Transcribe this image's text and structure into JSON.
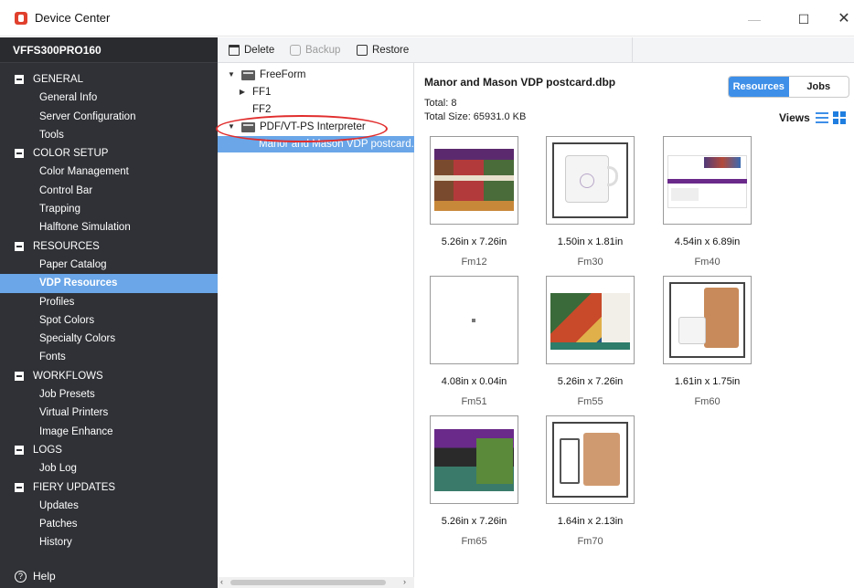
{
  "window": {
    "title": "Device Center"
  },
  "sidebar": {
    "device_name": "VFFS300PRO160",
    "groups": [
      {
        "label": "GENERAL",
        "items": [
          "General Info",
          "Server Configuration",
          "Tools"
        ]
      },
      {
        "label": "COLOR SETUP",
        "items": [
          "Color Management",
          "Control Bar",
          "Trapping",
          "Halftone Simulation"
        ]
      },
      {
        "label": "RESOURCES",
        "items": [
          "Paper Catalog",
          "VDP Resources",
          "Profiles",
          "Spot Colors",
          "Specialty Colors",
          "Fonts"
        ]
      },
      {
        "label": "WORKFLOWS",
        "items": [
          "Job Presets",
          "Virtual Printers",
          "Image Enhance"
        ]
      },
      {
        "label": "LOGS",
        "items": [
          "Job Log"
        ]
      },
      {
        "label": "FIERY UPDATES",
        "items": [
          "Updates",
          "Patches",
          "History"
        ]
      }
    ],
    "selected_item": "VDP Resources",
    "help_label": "Help"
  },
  "toolbar": {
    "delete_label": "Delete",
    "backup_label": "Backup",
    "restore_label": "Restore"
  },
  "tree": {
    "nodes": [
      {
        "label": "FreeForm",
        "expander": "▼"
      },
      {
        "label": "FF1",
        "expander": "▶"
      },
      {
        "label": "FF2",
        "expander": ""
      },
      {
        "label": "PDF/VT-PS Interpreter",
        "expander": "▼"
      },
      {
        "label": "Manor and Mason VDP postcard.d",
        "expander": ""
      }
    ]
  },
  "content": {
    "file_title": "Manor and Mason VDP postcard.dbp",
    "total": "Total: 8",
    "total_size": "Total Size: 65931.0 KB",
    "tabs": [
      "Resources",
      "Jobs"
    ],
    "active_tab": "Resources",
    "views_label": "Views",
    "thumbnails": [
      {
        "dims": "5.26in x 7.26in",
        "name": "Fm12"
      },
      {
        "dims": "1.50in x 1.81in",
        "name": "Fm30"
      },
      {
        "dims": "4.54in x 6.89in",
        "name": "Fm40"
      },
      {
        "dims": "4.08in x 0.04in",
        "name": "Fm51"
      },
      {
        "dims": "5.26in x 7.26in",
        "name": "Fm55"
      },
      {
        "dims": "1.61in x 1.75in",
        "name": "Fm60"
      },
      {
        "dims": "5.26in x 7.26in",
        "name": "Fm65"
      },
      {
        "dims": "1.64in x 2.13in",
        "name": "Fm70"
      }
    ]
  },
  "colors": {
    "sidebar_bg": "#2f3136",
    "selection": "#6aa6e8",
    "accent": "#3e8fe8",
    "annotation": "#e12d2d"
  },
  "icons": [
    "app-icon",
    "trash-icon",
    "backup-icon",
    "restore-icon",
    "list-view-icon",
    "grid-view-icon",
    "help-icon",
    "folder-icon"
  ]
}
